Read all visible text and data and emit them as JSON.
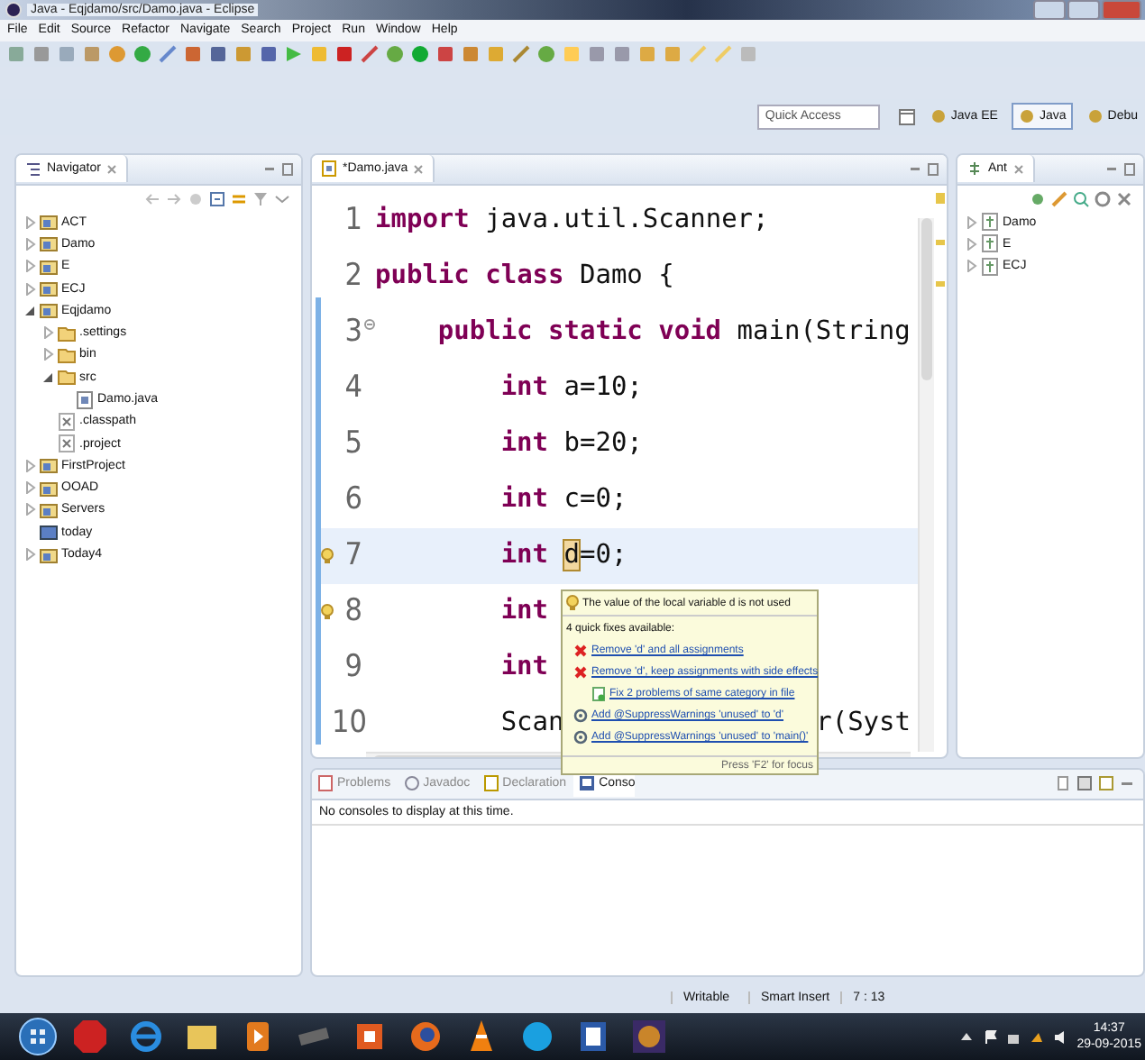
{
  "window": {
    "title": "Java - Eqjdamo/src/Damo.java - Eclipse"
  },
  "menu": [
    "File",
    "Edit",
    "Source",
    "Refactor",
    "Navigate",
    "Search",
    "Project",
    "Run",
    "Window",
    "Help"
  ],
  "quick_access": {
    "placeholder": "Quick Access"
  },
  "perspectives": [
    {
      "label": "Java EE",
      "selected": false
    },
    {
      "label": "Java",
      "selected": true
    },
    {
      "label": "Debu",
      "selected": false
    }
  ],
  "navigator": {
    "title": "Navigator",
    "items": [
      {
        "label": "ACT",
        "kind": "project",
        "expanded": false
      },
      {
        "label": "Damo",
        "kind": "project",
        "expanded": false
      },
      {
        "label": "E",
        "kind": "project",
        "expanded": false
      },
      {
        "label": "ECJ",
        "kind": "project",
        "expanded": false
      },
      {
        "label": "Eqjdamo",
        "kind": "project",
        "expanded": true,
        "children": [
          {
            "label": ".settings",
            "kind": "folder",
            "expanded": false
          },
          {
            "label": "bin",
            "kind": "folder",
            "expanded": false
          },
          {
            "label": "src",
            "kind": "folder",
            "expanded": true,
            "children": [
              {
                "label": "Damo.java",
                "kind": "java"
              }
            ]
          },
          {
            "label": ".classpath",
            "kind": "xml"
          },
          {
            "label": ".project",
            "kind": "xml"
          }
        ]
      },
      {
        "label": "FirstProject",
        "kind": "project",
        "expanded": false
      },
      {
        "label": "OOAD",
        "kind": "project",
        "expanded": false
      },
      {
        "label": "Servers",
        "kind": "project",
        "expanded": false
      },
      {
        "label": "today",
        "kind": "closed"
      },
      {
        "label": "Today4",
        "kind": "project",
        "expanded": false
      }
    ]
  },
  "editor": {
    "tab": "*Damo.java",
    "lines": [
      {
        "number": "1",
        "tokens": [
          {
            "text": "import",
            "kind": "keyword"
          },
          {
            "text": " java.util.Scanner;",
            "kind": "plain"
          }
        ]
      },
      {
        "number": "2",
        "tokens": [
          {
            "text": "public class",
            "kind": "keyword"
          },
          {
            "text": " Damo {",
            "kind": "plain"
          }
        ],
        "children": [
          {
            "number": "3",
            "fold": true,
            "tokens": [
              {
                "text": "public static void",
                "kind": "keyword"
              },
              {
                "text": " main(String",
                "kind": "plain"
              }
            ],
            "children": [
              {
                "number": "4",
                "tokens": [
                  {
                    "text": "int",
                    "kind": "keyword"
                  },
                  {
                    "text": " a=10;",
                    "kind": "plain"
                  }
                ]
              },
              {
                "number": "5",
                "tokens": [
                  {
                    "text": "int",
                    "kind": "keyword"
                  },
                  {
                    "text": " b=20;",
                    "kind": "plain"
                  }
                ]
              },
              {
                "number": "6",
                "tokens": [
                  {
                    "text": "int",
                    "kind": "keyword"
                  },
                  {
                    "text": " c=0;",
                    "kind": "plain"
                  }
                ]
              },
              {
                "number": "7",
                "current": true,
                "warning": true,
                "tokens": [
                  {
                    "text": "int",
                    "kind": "keyword"
                  },
                  {
                    "text": "d",
                    "kind": "marked"
                  },
                  {
                    "text": "=0;",
                    "kind": "plain"
                  }
                ]
              },
              {
                "number": "8",
                "warning": true,
                "tokens": [
                  {
                    "text": "int",
                    "kind": "keyword"
                  }
                ]
              },
              {
                "number": "9",
                "tokens": [
                  {
                    "text": "int",
                    "kind": "keyword"
                  }
                ]
              },
              {
                "number": "10",
                "tokens": [
                  {
                    "text": "Scan",
                    "kind": "plain"
                  },
                  {
                    "text": "r(Syst",
                    "kind": "tail"
                  }
                ]
              }
            ]
          }
        ]
      }
    ]
  },
  "quick_fix": {
    "message": "The value of the local variable d is not used",
    "summary": "4 quick fixes available:",
    "fixes": [
      {
        "label": "Remove 'd' and all assignments",
        "kind": "remove"
      },
      {
        "label": "Remove 'd', keep assignments with side effects",
        "kind": "remove"
      },
      {
        "label": "Fix 2 problems of same category in file",
        "kind": "fix-all"
      },
      {
        "label": "Add @SuppressWarnings 'unused' to 'd'",
        "kind": "annotate"
      },
      {
        "label": "Add @SuppressWarnings 'unused' to 'main()'",
        "kind": "annotate"
      }
    ],
    "footer": "Press 'F2' for focus"
  },
  "ant": {
    "title": "Ant",
    "items": [
      {
        "label": "Damo",
        "expanded": false
      },
      {
        "label": "E",
        "expanded": false
      },
      {
        "label": "ECJ",
        "expanded": false
      }
    ]
  },
  "bottom_tabs": [
    {
      "label": "Problems",
      "kind": "problems",
      "selected": false
    },
    {
      "label": "Javadoc",
      "kind": "javadoc",
      "selected": false
    },
    {
      "label": "Declaration",
      "kind": "declaration",
      "selected": false
    },
    {
      "label": "Conso",
      "kind": "console",
      "selected": true
    }
  ],
  "console": {
    "message": "No consoles to display at this time."
  },
  "status_bar": [
    "Writable",
    "Smart Insert",
    "7 : 13"
  ],
  "taskbar": {
    "time": "14:37",
    "date": "29-09-2015"
  }
}
